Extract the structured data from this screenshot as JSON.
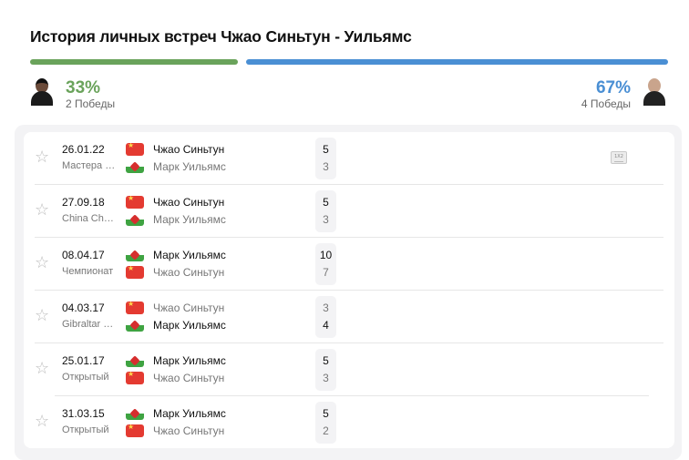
{
  "title": "История личных встреч Чжао Синьтун - Уильямс",
  "left": {
    "percent": "33%",
    "wins": "2 Победы",
    "color": "#6aa35b",
    "bar_share": 0.33
  },
  "right": {
    "percent": "67%",
    "wins": "4 Победы",
    "color": "#4a8fd4",
    "bar_share": 0.67
  },
  "odds_icon_text": "1X2",
  "matches": [
    {
      "date": "26.01.22",
      "tournament": "Мастера Германии",
      "p1": {
        "name": "Чжао Синьтун",
        "flag": "china",
        "score": "5",
        "winner": true
      },
      "p2": {
        "name": "Марк Уильямс",
        "flag": "wales",
        "score": "3",
        "winner": false
      }
    },
    {
      "date": "27.09.18",
      "tournament": "China Championship",
      "p1": {
        "name": "Чжао Синьтун",
        "flag": "china",
        "score": "5",
        "winner": true
      },
      "p2": {
        "name": "Марк Уильямс",
        "flag": "wales",
        "score": "3",
        "winner": false
      }
    },
    {
      "date": "08.04.17",
      "tournament": "Чемпионат",
      "p1": {
        "name": "Марк Уильямс",
        "flag": "wales",
        "score": "10",
        "winner": true
      },
      "p2": {
        "name": "Чжао Синьтун",
        "flag": "china",
        "score": "7",
        "winner": false
      }
    },
    {
      "date": "04.03.17",
      "tournament": "Gibraltar Open",
      "p1": {
        "name": "Чжао Синьтун",
        "flag": "china",
        "score": "3",
        "winner": false
      },
      "p2": {
        "name": "Марк Уильямс",
        "flag": "wales",
        "score": "4",
        "winner": true
      }
    },
    {
      "date": "25.01.17",
      "tournament": "Открытый",
      "p1": {
        "name": "Марк Уильямс",
        "flag": "wales",
        "score": "5",
        "winner": true
      },
      "p2": {
        "name": "Чжао Синьтун",
        "flag": "china",
        "score": "3",
        "winner": false
      }
    },
    {
      "date": "31.03.15",
      "tournament": "Открытый",
      "p1": {
        "name": "Марк Уильямс",
        "flag": "wales",
        "score": "5",
        "winner": true
      },
      "p2": {
        "name": "Чжао Синьтун",
        "flag": "china",
        "score": "2",
        "winner": false
      }
    }
  ]
}
